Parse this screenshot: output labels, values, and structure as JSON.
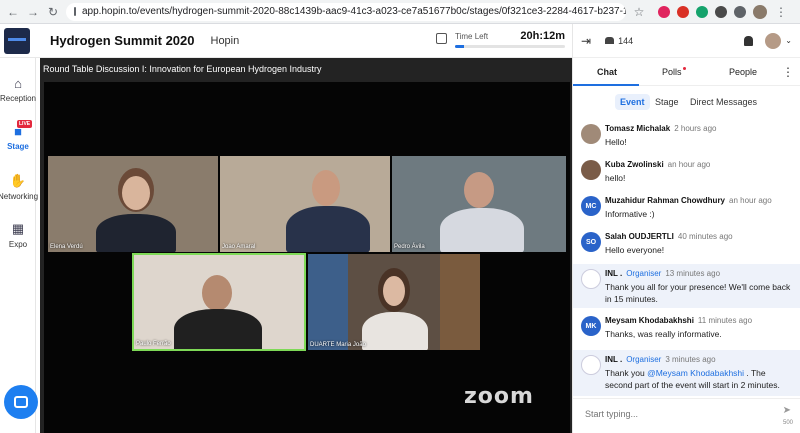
{
  "browser": {
    "url": "app.hopin.to/events/hydrogen-summit-2020-88c1439b-aac9-41c3-a023-ce7a51677b0c/stages/0f321ce3-2284-4617-b237-11b528bcef14"
  },
  "header": {
    "event_title": "Hydrogen Summit 2020",
    "org_name": "Hopin",
    "time_left_label": "Time Left",
    "time_left_value": "20h:12m",
    "time_left_fraction": 0.08
  },
  "nav": {
    "items": [
      {
        "label": "Reception",
        "icon": "home-icon"
      },
      {
        "label": "Stage",
        "icon": "video-camera-icon"
      },
      {
        "label": "Networking",
        "icon": "handshake-icon"
      },
      {
        "label": "Expo",
        "icon": "storefront-icon"
      }
    ],
    "live_badge": "LIVE"
  },
  "stage": {
    "title": "Round Table Discussion I: Innovation for European Hydrogen Industry",
    "participants": [
      {
        "name": "Elena Verdú"
      },
      {
        "name": "Joao Amaral"
      },
      {
        "name": "Pedro Ávila"
      },
      {
        "name": "Paulo Ferrão"
      },
      {
        "name": "DUARTE Maria João"
      }
    ],
    "zoom_label": "zoom"
  },
  "panel": {
    "attendee_count": "144",
    "tabs": [
      "Chat",
      "Polls",
      "People"
    ],
    "subtabs": [
      "Event",
      "Stage",
      "Direct Messages"
    ],
    "composer_placeholder": "Start typing...",
    "char_count": "500"
  },
  "messages": [
    {
      "name": "Tomasz Michalak",
      "time": "2 hours ago",
      "text": "Hello!"
    },
    {
      "name": "Kuba Zwolinski",
      "time": "an hour ago",
      "text": "hello!"
    },
    {
      "name": "Muzahidur Rahman Chowdhury",
      "time": "an hour ago",
      "text": "Informative :)",
      "initials": "MC"
    },
    {
      "name": "Salah OUDJERTLI",
      "time": "40 minutes ago",
      "text": "Hello everyone!",
      "initials": "SO"
    },
    {
      "name": "INL .",
      "role": "Organiser",
      "time": "13 minutes ago",
      "text": "Thank you all for your presence! We'll come back in 15 minutes."
    },
    {
      "name": "Meysam Khodabakhshi",
      "time": "11 minutes ago",
      "text": "Thanks, was really informative.",
      "initials": "MK"
    },
    {
      "name": "INL .",
      "role": "Organiser",
      "time": "3 minutes ago",
      "text_before": "Thank you ",
      "mention": "@Meysam Khodabakhshi",
      "text_after": " . The second part of the event will start in 2 minutes."
    }
  ],
  "colors": {
    "accent": "#1e6fe0",
    "live": "#e3283d",
    "active_speaker_border": "#7ed957"
  }
}
